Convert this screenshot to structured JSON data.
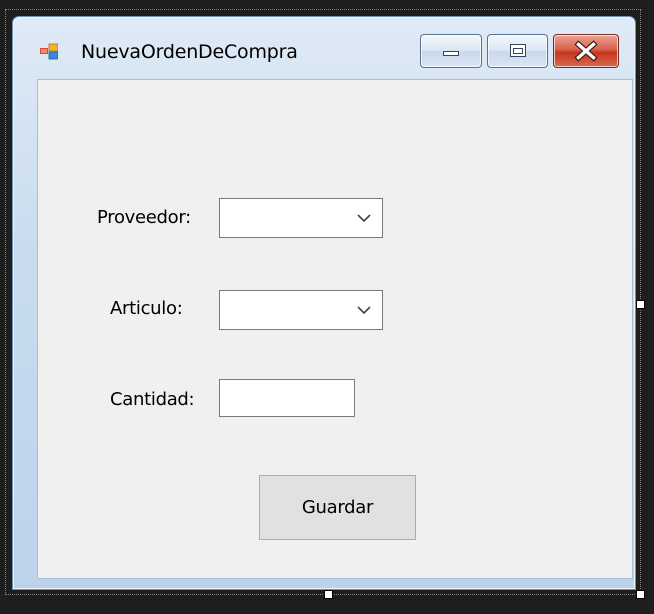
{
  "window": {
    "title": "NuevaOrdenDeCompra",
    "icon": "windows-form-icon"
  },
  "caption_buttons": {
    "minimize": "minimize-icon",
    "maximize": "maximize-icon",
    "close": "close-icon"
  },
  "form": {
    "proveedor_label": "Proveedor:",
    "proveedor_value": "",
    "articulo_label": "Articulo:",
    "articulo_value": "",
    "cantidad_label": "Cantidad:",
    "cantidad_value": "",
    "guardar_label": "Guardar"
  },
  "colors": {
    "client_background": "#f0f0f0",
    "close_button": "#c7351f",
    "frame_border": "#6f8fb3"
  }
}
